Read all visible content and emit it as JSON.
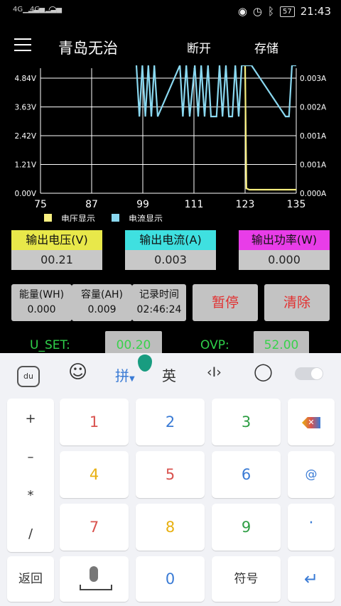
{
  "status_bar": {
    "signal_1": "4G",
    "signal_2": "4G",
    "battery": "57",
    "time": "21:43"
  },
  "appbar": {
    "title": "青岛无治",
    "disconnect_label": "断开",
    "save_label": "存储"
  },
  "chart_data": {
    "type": "line",
    "x_ticks": [
      "75",
      "87",
      "99",
      "111",
      "123",
      "135"
    ],
    "y_left_ticks": [
      "4.84V",
      "3.63V",
      "2.42V",
      "1.21V",
      "0.00V"
    ],
    "y_right_ticks": [
      "0.003A",
      "0.002A",
      "0.001A",
      "0.001A",
      "0.000A"
    ],
    "xlim": [
      75,
      135
    ],
    "ylim_left": [
      0,
      4.84
    ],
    "ylim_right": [
      0,
      0.003
    ],
    "legend": [
      "电压显示",
      "电流显示"
    ],
    "series": [
      {
        "name": "电压显示",
        "color": "#f8f080",
        "axis": "left",
        "x": [
          123,
          123.3,
          124,
          135
        ],
        "y": [
          4.84,
          0.2,
          0.15,
          0.15
        ]
      },
      {
        "name": "电流显示",
        "color": "#8ad8f0",
        "axis": "right",
        "x": [
          97.5,
          98.2,
          98.9,
          99.6,
          100.3,
          101.0,
          101.7,
          102.5,
          107.7,
          108.4,
          109.2,
          110.0,
          111.2,
          112.0,
          112.7,
          113.5,
          114.3,
          115.0,
          115.5,
          116.3,
          117.0,
          117.7,
          118.5,
          119.2,
          120.0,
          120.7,
          121.5,
          122.2,
          123.0,
          123.8,
          124.5,
          132.5,
          133.3,
          134.0,
          134.8,
          135.0
        ],
        "y": [
          0.003,
          0.002,
          0.003,
          0.002,
          0.003,
          0.002,
          0.003,
          0.002,
          0.003,
          0.002,
          0.003,
          0.002,
          0.003,
          0.002,
          0.003,
          0.002,
          0.003,
          0.002,
          0.002,
          0.002,
          0.003,
          0.002,
          0.003,
          0.002,
          0.002,
          0.003,
          0.002,
          0.003,
          0.003,
          0.003,
          0.003,
          0.002,
          0.002,
          0.003,
          0.003,
          0.003
        ]
      }
    ]
  },
  "meters": {
    "voltage_label": "输出电压(V)",
    "voltage_value": "00.21",
    "current_label": "输出电流(A)",
    "current_value": "0.003",
    "power_label": "输出功率(W)",
    "power_value": "0.000"
  },
  "stats": {
    "energy_label": "能量(WH)",
    "energy_value": "0.000",
    "capacity_label": "容量(AH)",
    "capacity_value": "0.009",
    "time_label": "记录时间",
    "time_value": "02:46:24",
    "pause_label": "暂停",
    "clear_label": "清除"
  },
  "settings": {
    "uset_label": "U_SET:",
    "uset_value": "00.20",
    "ovp_label": "OVP:",
    "ovp_value": "52.00"
  },
  "keyboard": {
    "toolbar": {
      "pinyin": "拼",
      "english": "英"
    },
    "symbols": [
      "+",
      "–",
      "*",
      "/"
    ],
    "digits": [
      {
        "label": "1",
        "color": "#d9534f"
      },
      {
        "label": "2",
        "color": "#3a7bd5"
      },
      {
        "label": "3",
        "color": "#2e9e44"
      },
      {
        "label": "4",
        "color": "#e8b010"
      },
      {
        "label": "5",
        "color": "#d9534f"
      },
      {
        "label": "6",
        "color": "#3a7bd5"
      },
      {
        "label": "7",
        "color": "#d9534f"
      },
      {
        "label": "8",
        "color": "#e8b010"
      },
      {
        "label": "9",
        "color": "#2e9e44"
      },
      {
        "label": "0",
        "color": "#3a7bd5"
      }
    ],
    "at_label": "@",
    "dot_label": "·",
    "back_label": "返回",
    "symbol_key_label": "符号"
  }
}
